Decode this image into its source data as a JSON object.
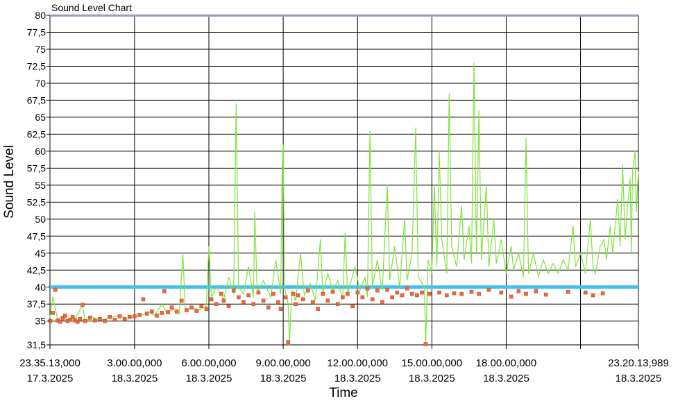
{
  "chart_data": {
    "type": "line",
    "title": "Sound Level Chart",
    "xlabel": "Time",
    "ylabel": "Sound Level",
    "ylim": [
      31.5,
      80
    ],
    "y_ticks": [
      "31,5",
      "35",
      "37,5",
      "40",
      "42,5",
      "45",
      "47,5",
      "50",
      "52,5",
      "55",
      "57,5",
      "60",
      "62,5",
      "65",
      "67,5",
      "70",
      "72,5",
      "75",
      "77,5",
      "80"
    ],
    "x_range_hours": [
      -0.414,
      23.337
    ],
    "x_ticks": [
      {
        "t": -0.414,
        "line1": "23.35.13,000",
        "line2": "17.3.2025"
      },
      {
        "t": 3,
        "line1": "3.00.00,000",
        "line2": "18.3.2025"
      },
      {
        "t": 6,
        "line1": "6.00.00,000",
        "line2": "18.3.2025"
      },
      {
        "t": 9,
        "line1": "9.00.00,000",
        "line2": "18.3.2025"
      },
      {
        "t": 12,
        "line1": "12.00.00,000",
        "line2": "18.3.2025"
      },
      {
        "t": 15,
        "line1": "15.00.00,000",
        "line2": "18.3.2025"
      },
      {
        "t": 18,
        "line1": "18.00.00,000",
        "line2": "18.3.2025"
      },
      {
        "t": 21,
        "line1": "",
        "line2": ""
      },
      {
        "t": 23.337,
        "line1": "23.20.13,989",
        "line2": "18.3.2025"
      }
    ],
    "threshold": {
      "y": 40,
      "color": "#45c0ee"
    },
    "grid": true,
    "series": [
      {
        "color": "#7fe33a",
        "points": [
          [
            -0.414,
            35.5
          ],
          [
            -0.3,
            38.6
          ],
          [
            -0.1,
            35.2
          ],
          [
            0.1,
            35.8
          ],
          [
            0.3,
            35.0
          ],
          [
            0.6,
            35.4
          ],
          [
            0.9,
            37.3
          ],
          [
            1.0,
            35.0
          ],
          [
            1.3,
            35.6
          ],
          [
            1.6,
            35.1
          ],
          [
            2.0,
            35.5
          ],
          [
            2.4,
            35.8
          ],
          [
            2.7,
            35.3
          ],
          [
            3.0,
            35.7
          ],
          [
            3.3,
            35.9
          ],
          [
            3.6,
            36.3
          ],
          [
            3.8,
            35.8
          ],
          [
            4.1,
            37.5
          ],
          [
            4.3,
            36.2
          ],
          [
            4.6,
            36.8
          ],
          [
            4.8,
            36.0
          ],
          [
            4.95,
            45.0
          ],
          [
            5.05,
            36.4
          ],
          [
            5.3,
            37.0
          ],
          [
            5.6,
            36.6
          ],
          [
            5.9,
            37.2
          ],
          [
            6.0,
            46.0
          ],
          [
            6.1,
            38.5
          ],
          [
            6.3,
            40.0
          ],
          [
            6.6,
            38.2
          ],
          [
            6.8,
            41.5
          ],
          [
            7.0,
            39.0
          ],
          [
            7.1,
            67.0
          ],
          [
            7.2,
            40.0
          ],
          [
            7.4,
            39.0
          ],
          [
            7.6,
            43.0
          ],
          [
            7.8,
            38.5
          ],
          [
            7.85,
            51.0
          ],
          [
            7.95,
            39.2
          ],
          [
            8.2,
            41.0
          ],
          [
            8.5,
            38.5
          ],
          [
            8.7,
            44.0
          ],
          [
            8.9,
            39.0
          ],
          [
            8.95,
            56.0
          ],
          [
            9.0,
            61.0
          ],
          [
            9.05,
            40.0
          ],
          [
            9.2,
            37.5
          ],
          [
            9.25,
            31.5
          ],
          [
            9.35,
            39.5
          ],
          [
            9.5,
            38.0
          ],
          [
            9.7,
            45.0
          ],
          [
            9.85,
            38.8
          ],
          [
            10.1,
            40.5
          ],
          [
            10.3,
            38.0
          ],
          [
            10.5,
            47.0
          ],
          [
            10.6,
            39.0
          ],
          [
            10.8,
            42.0
          ],
          [
            11.0,
            39.5
          ],
          [
            11.2,
            41.0
          ],
          [
            11.4,
            38.2
          ],
          [
            11.5,
            48.0
          ],
          [
            11.6,
            39.0
          ],
          [
            11.9,
            43.0
          ],
          [
            12.1,
            39.5
          ],
          [
            12.3,
            41.5
          ],
          [
            12.4,
            38.5
          ],
          [
            12.5,
            63.0
          ],
          [
            12.6,
            40.0
          ],
          [
            12.8,
            44.0
          ],
          [
            13.0,
            39.5
          ],
          [
            13.2,
            55.0
          ],
          [
            13.3,
            41.0
          ],
          [
            13.5,
            46.0
          ],
          [
            13.7,
            40.0
          ],
          [
            13.9,
            50.0
          ],
          [
            14.0,
            41.0
          ],
          [
            14.2,
            45.0
          ],
          [
            14.35,
            63.5
          ],
          [
            14.45,
            41.5
          ],
          [
            14.7,
            40.0
          ],
          [
            14.75,
            31.5
          ],
          [
            14.85,
            44.0
          ],
          [
            15.0,
            42.0
          ],
          [
            15.1,
            55.0
          ],
          [
            15.2,
            43.0
          ],
          [
            15.3,
            60.0
          ],
          [
            15.4,
            47.0
          ],
          [
            15.6,
            42.0
          ],
          [
            15.7,
            68.5
          ],
          [
            15.8,
            46.0
          ],
          [
            16.0,
            43.0
          ],
          [
            16.2,
            52.0
          ],
          [
            16.3,
            44.0
          ],
          [
            16.5,
            49.0
          ],
          [
            16.6,
            43.5
          ],
          [
            16.7,
            73.0
          ],
          [
            16.8,
            45.0
          ],
          [
            16.9,
            66.0
          ],
          [
            17.0,
            44.0
          ],
          [
            17.2,
            55.0
          ],
          [
            17.3,
            43.0
          ],
          [
            17.5,
            50.0
          ],
          [
            17.6,
            43.5
          ],
          [
            17.8,
            47.0
          ],
          [
            18.0,
            42.0
          ],
          [
            18.2,
            46.0
          ],
          [
            18.3,
            42.5
          ],
          [
            18.5,
            45.0
          ],
          [
            18.7,
            41.5
          ],
          [
            18.8,
            62.0
          ],
          [
            18.9,
            42.0
          ],
          [
            19.1,
            45.0
          ],
          [
            19.3,
            41.5
          ],
          [
            19.5,
            44.0
          ],
          [
            19.7,
            42.0
          ],
          [
            19.9,
            43.5
          ],
          [
            20.1,
            42.0
          ],
          [
            20.3,
            44.0
          ],
          [
            20.5,
            42.5
          ],
          [
            20.7,
            49.0
          ],
          [
            20.8,
            43.0
          ],
          [
            21.0,
            45.0
          ],
          [
            21.2,
            42.0
          ],
          [
            21.4,
            50.0
          ],
          [
            21.5,
            43.0
          ],
          [
            21.6,
            42.0
          ],
          [
            21.8,
            46.0
          ],
          [
            21.95,
            47.0
          ],
          [
            22.05,
            44.0
          ],
          [
            22.2,
            49.0
          ],
          [
            22.3,
            45.0
          ],
          [
            22.5,
            53.0
          ],
          [
            22.6,
            46.0
          ],
          [
            22.7,
            58.0
          ],
          [
            22.8,
            47.0
          ],
          [
            22.9,
            52.0
          ],
          [
            23.0,
            56.0
          ],
          [
            23.05,
            45.0
          ],
          [
            23.1,
            57.0
          ],
          [
            23.2,
            60.0
          ],
          [
            23.25,
            51.0
          ],
          [
            23.337,
            57.0
          ]
        ]
      },
      {
        "color": "#ec6a3b",
        "points": [
          [
            -0.4,
            35.0
          ],
          [
            -0.3,
            36.2
          ],
          [
            -0.2,
            39.6
          ],
          [
            -0.1,
            35.1
          ],
          [
            0.0,
            34.9
          ],
          [
            0.1,
            35.4
          ],
          [
            0.2,
            35.8
          ],
          [
            0.3,
            35.0
          ],
          [
            0.4,
            35.2
          ],
          [
            0.5,
            35.6
          ],
          [
            0.6,
            35.1
          ],
          [
            0.7,
            34.9
          ],
          [
            0.8,
            35.3
          ],
          [
            0.9,
            37.4
          ],
          [
            1.0,
            35.0
          ],
          [
            1.2,
            35.5
          ],
          [
            1.4,
            35.1
          ],
          [
            1.6,
            35.3
          ],
          [
            1.8,
            35.0
          ],
          [
            2.0,
            35.6
          ],
          [
            2.2,
            35.2
          ],
          [
            2.4,
            35.7
          ],
          [
            2.6,
            35.3
          ],
          [
            2.8,
            35.6
          ],
          [
            3.0,
            35.7
          ],
          [
            3.2,
            35.9
          ],
          [
            3.35,
            38.2
          ],
          [
            3.5,
            36.1
          ],
          [
            3.7,
            36.4
          ],
          [
            3.9,
            35.8
          ],
          [
            4.1,
            36.2
          ],
          [
            4.2,
            39.4
          ],
          [
            4.35,
            36.3
          ],
          [
            4.5,
            37.0
          ],
          [
            4.7,
            36.4
          ],
          [
            4.9,
            38.0
          ],
          [
            5.1,
            36.6
          ],
          [
            5.3,
            37.0
          ],
          [
            5.5,
            36.5
          ],
          [
            5.7,
            37.2
          ],
          [
            5.9,
            36.8
          ],
          [
            6.1,
            38.2
          ],
          [
            6.3,
            37.5
          ],
          [
            6.5,
            39.0
          ],
          [
            6.6,
            38.0
          ],
          [
            6.8,
            37.2
          ],
          [
            7.0,
            39.5
          ],
          [
            7.2,
            38.5
          ],
          [
            7.4,
            37.8
          ],
          [
            7.6,
            38.8
          ],
          [
            7.8,
            37.5
          ],
          [
            8.0,
            39.2
          ],
          [
            8.2,
            38.0
          ],
          [
            8.4,
            37.0
          ],
          [
            8.6,
            39.0
          ],
          [
            8.8,
            37.8
          ],
          [
            8.9,
            36.8
          ],
          [
            9.1,
            38.5
          ],
          [
            9.2,
            31.9
          ],
          [
            9.4,
            39.0
          ],
          [
            9.5,
            37.5
          ],
          [
            9.6,
            38.8
          ],
          [
            9.8,
            38.2
          ],
          [
            10.0,
            39.5
          ],
          [
            10.2,
            37.8
          ],
          [
            10.4,
            36.8
          ],
          [
            10.6,
            39.0
          ],
          [
            10.8,
            38.0
          ],
          [
            11.0,
            39.3
          ],
          [
            11.2,
            37.5
          ],
          [
            11.4,
            38.5
          ],
          [
            11.6,
            39.0
          ],
          [
            11.8,
            37.2
          ],
          [
            12.0,
            39.2
          ],
          [
            12.2,
            38.5
          ],
          [
            12.4,
            39.8
          ],
          [
            12.6,
            38.2
          ],
          [
            12.8,
            39.5
          ],
          [
            13.0,
            37.8
          ],
          [
            13.2,
            39.6
          ],
          [
            13.4,
            38.5
          ],
          [
            13.6,
            39.2
          ],
          [
            13.8,
            38.8
          ],
          [
            14.0,
            39.8
          ],
          [
            14.2,
            39.0
          ],
          [
            14.4,
            38.8
          ],
          [
            14.6,
            39.2
          ],
          [
            14.75,
            31.6
          ],
          [
            14.9,
            39.0
          ],
          [
            15.3,
            39.2
          ],
          [
            15.6,
            38.8
          ],
          [
            15.9,
            39.1
          ],
          [
            16.2,
            39.0
          ],
          [
            16.6,
            39.3
          ],
          [
            16.9,
            39.0
          ],
          [
            17.3,
            39.6
          ],
          [
            17.8,
            39.2
          ],
          [
            18.2,
            38.6
          ],
          [
            18.5,
            39.4
          ],
          [
            18.8,
            39.0
          ],
          [
            19.2,
            39.4
          ],
          [
            19.6,
            38.9
          ],
          [
            20.5,
            39.3
          ],
          [
            21.2,
            39.2
          ],
          [
            21.5,
            38.8
          ],
          [
            21.9,
            39.1
          ]
        ]
      }
    ]
  }
}
